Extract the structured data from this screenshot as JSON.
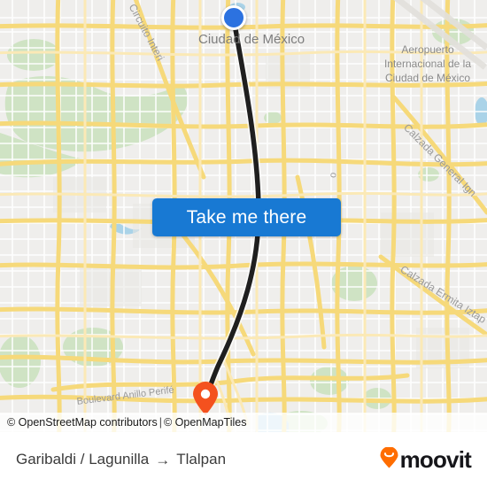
{
  "map": {
    "provider_tiles": "OpenMapTiles",
    "origin_marker": {
      "icon": "origin-dot-icon",
      "color": "#2c72e0"
    },
    "destination_marker": {
      "icon": "destination-pin-icon",
      "color": "#f4511e"
    },
    "route_line_color": "#1f1f1f",
    "labels": {
      "city": "Ciudad de México",
      "airport": "Aeropuerto Internacional de la Ciudad de México",
      "road_circuito": "Circuito Interi",
      "road_calzada_general": "Calzada General Ign",
      "road_calzada_ermita": "Calzada Ermita Iztap",
      "road_periferico": "Boulevard Anillo Perifé",
      "road_vertical": "o"
    },
    "attribution": {
      "osm": "© OpenStreetMap contributors",
      "separator": "|",
      "tiles": "© OpenMapTiles"
    }
  },
  "cta": {
    "label": "Take me there",
    "color": "#1879d3"
  },
  "footer": {
    "origin": "Garibaldi / Lagunilla",
    "arrow": "→",
    "destination": "Tlalpan",
    "brand": {
      "name": "moovit",
      "logo_color": "#ff6d00"
    }
  }
}
